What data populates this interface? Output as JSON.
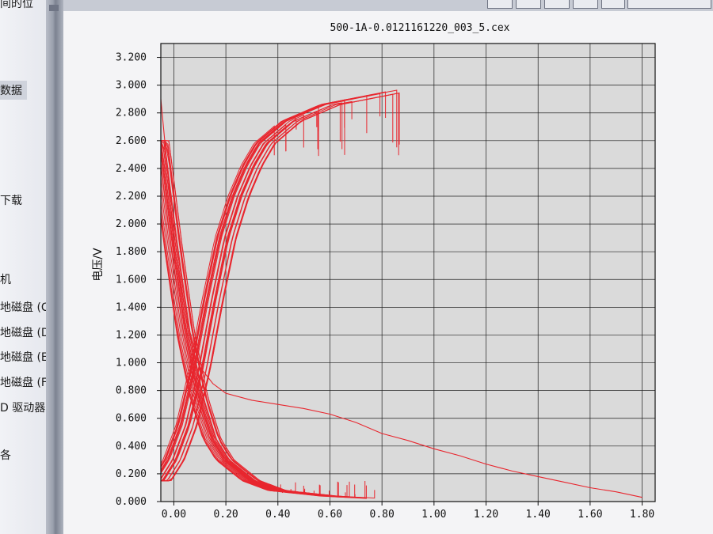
{
  "left_panel": {
    "items": [
      {
        "label": "间的位",
        "selected": false
      },
      {
        "label": "数据",
        "selected": true
      },
      {
        "label": "下载",
        "selected": false
      },
      {
        "label": "机",
        "selected": false
      },
      {
        "label": "地磁盘 (C:)",
        "selected": false
      },
      {
        "label": "地磁盘 (D:)",
        "selected": false
      },
      {
        "label": "地磁盘 (E:)",
        "selected": false
      },
      {
        "label": "地磁盘 (F:)",
        "selected": false
      },
      {
        "label": "D 驱动器 (K",
        "selected": false
      },
      {
        "label": "各",
        "selected": false
      }
    ]
  },
  "chart_data": {
    "type": "line",
    "title": "500-1A-0.0121161220_003_5.cex",
    "xlabel": "",
    "ylabel": "电压/V",
    "xlim": [
      -0.05,
      1.85
    ],
    "ylim": [
      0.0,
      3.3
    ],
    "x_ticks": [
      "0.00",
      "0.20",
      "0.40",
      "0.60",
      "0.80",
      "1.00",
      "1.20",
      "1.40",
      "1.60",
      "1.80"
    ],
    "y_ticks": [
      "0.000",
      "0.200",
      "0.400",
      "0.600",
      "0.800",
      "1.000",
      "1.200",
      "1.400",
      "1.600",
      "1.800",
      "2.000",
      "2.200",
      "2.400",
      "2.600",
      "2.800",
      "3.000",
      "3.200"
    ],
    "grid": true,
    "color": "#e8262e",
    "plot_background": "#dadada",
    "charge_curves": {
      "count": 24,
      "x_end_range": [
        0.38,
        0.9
      ],
      "points": [
        [
          -0.05,
          0.15
        ],
        [
          0.0,
          0.3
        ],
        [
          0.05,
          0.55
        ],
        [
          0.1,
          0.95
        ],
        [
          0.15,
          1.45
        ],
        [
          0.2,
          1.9
        ],
        [
          0.25,
          2.2
        ],
        [
          0.3,
          2.42
        ],
        [
          0.35,
          2.58
        ],
        [
          0.45,
          2.74
        ],
        [
          0.6,
          2.86
        ],
        [
          0.9,
          2.97
        ]
      ]
    },
    "discharge_curves": {
      "count": 24,
      "x_end_range": [
        0.38,
        0.78
      ],
      "points": [
        [
          -0.05,
          2.6
        ],
        [
          -0.02,
          2.15
        ],
        [
          0.0,
          1.85
        ],
        [
          0.05,
          1.2
        ],
        [
          0.1,
          0.75
        ],
        [
          0.15,
          0.45
        ],
        [
          0.2,
          0.3
        ],
        [
          0.3,
          0.15
        ],
        [
          0.4,
          0.08
        ],
        [
          0.6,
          0.04
        ],
        [
          0.8,
          0.02
        ]
      ]
    },
    "long_discharge": {
      "points": [
        [
          -0.05,
          2.9
        ],
        [
          -0.02,
          2.3
        ],
        [
          0.0,
          1.85
        ],
        [
          0.05,
          1.3
        ],
        [
          0.1,
          0.97
        ],
        [
          0.15,
          0.85
        ],
        [
          0.2,
          0.78
        ],
        [
          0.3,
          0.73
        ],
        [
          0.4,
          0.7
        ],
        [
          0.5,
          0.67
        ],
        [
          0.6,
          0.63
        ],
        [
          0.7,
          0.57
        ],
        [
          0.8,
          0.49
        ],
        [
          0.9,
          0.44
        ],
        [
          1.0,
          0.38
        ],
        [
          1.1,
          0.33
        ],
        [
          1.2,
          0.27
        ],
        [
          1.3,
          0.22
        ],
        [
          1.4,
          0.18
        ],
        [
          1.5,
          0.14
        ],
        [
          1.6,
          0.1
        ],
        [
          1.7,
          0.07
        ],
        [
          1.8,
          0.03
        ]
      ]
    }
  }
}
